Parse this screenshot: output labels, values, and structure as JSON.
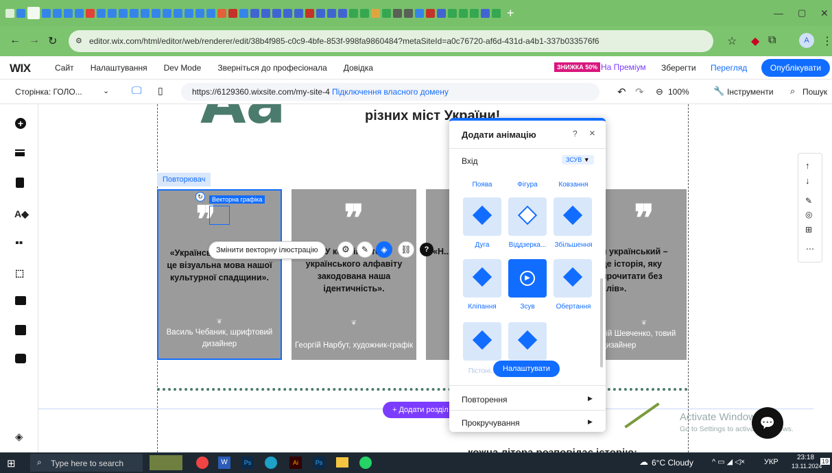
{
  "browser": {
    "url": "editor.wix.com/html/editor/web/renderer/edit/38b4f985-c0c9-4bfe-853f-998fa9860484?metaSiteId=a0c76720-af6d-431d-a4b1-337b033576f6",
    "new_tab": "+",
    "colors": {
      "tabbar": "#78c16a",
      "addr": "#7cc46e"
    }
  },
  "wix": {
    "logo": "WIX",
    "menu": [
      "Сайт",
      "Налаштування",
      "Dev Mode",
      "Зверніться до професіонала",
      "Довідка"
    ],
    "discount_badge": "ЗНИЖКА 50%",
    "premium": "На Преміум",
    "save": "Зберегти",
    "preview": "Перегляд",
    "publish": "Опублікувати"
  },
  "pagebar": {
    "page_label": "Сторінка: ГОЛО...",
    "site_url": "https://6129360.wixsite.com/my-site-4",
    "connect_domain": "Підключення власного домену",
    "zoom": "100%",
    "tools": "Інструменти",
    "search": "Пошук"
  },
  "canvas": {
    "heading_big": "Аа",
    "heading_text": "різних міст України!",
    "repeater_tag": "Повторювач",
    "vector_tag": "Векторна графіка",
    "change_vector_tooltip": "Змінити векторну ілюстрацію",
    "cards": [
      {
        "quote": "«Український шрифт — це візуальна мова нашої культурної спадщини».",
        "author": "Василь Чебаник, шрифтовий дизайнер"
      },
      {
        "quote": "«У кожній літері українського алфавіту закодована наша ідентичність».",
        "author": "Георгій Нарбут, художник-графік"
      },
      {
        "quote": "«Н... за...",
        "author": ""
      },
      {
        "quote": "н український – це історія, яку прочитати без слів».",
        "author": "рій Шевченко, товий дизайнер"
      }
    ],
    "add_section": "+ Додати розділ",
    "bottom_text": "кожна літера розповідає історію:"
  },
  "anim_panel": {
    "title": "Додати анімацію",
    "help": "?",
    "close": "×",
    "entry_label": "Вхід",
    "entry_value": "ЗСУВ",
    "top_labels": [
      "Поява",
      "Фігура",
      "Ковзання"
    ],
    "items": [
      {
        "label": "Дуга"
      },
      {
        "label": "Віддзерка..."
      },
      {
        "label": "Збільшення"
      },
      {
        "label": "Кліпання"
      },
      {
        "label": "Зсув"
      },
      {
        "label": "Обертання"
      },
      {
        "label": "Пістоні..."
      },
      {
        "label": ""
      }
    ],
    "customize": "Налаштувати",
    "repeat": "Повторення",
    "scroll": "Прокручування"
  },
  "watermark": {
    "line1": "Activate Windows",
    "line2": "Go to Settings to activate Windows."
  },
  "taskbar": {
    "search": "Type here to search",
    "weather": "6°C Cloudy",
    "lang": "УКР",
    "time": "23:18",
    "date": "13.11.2024",
    "badge": "19"
  }
}
